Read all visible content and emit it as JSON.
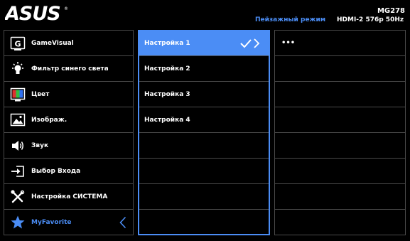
{
  "brand": {
    "logo": "ASUS"
  },
  "header": {
    "model": "MG278",
    "mode": "Пейзажный режим",
    "signal": "HDMI-2  576p 50Hz"
  },
  "menu": {
    "items": [
      {
        "label": "GameVisual",
        "icon": "gamevisual-icon"
      },
      {
        "label": "Фильтр синего света",
        "icon": "lightbulb-icon"
      },
      {
        "label": "Цвет",
        "icon": "color-palette-icon"
      },
      {
        "label": "Изображ.",
        "icon": "image-icon"
      },
      {
        "label": "Звук",
        "icon": "speaker-icon"
      },
      {
        "label": "Выбор Входа",
        "icon": "input-select-icon"
      },
      {
        "label": "Настройка СИСТЕМА",
        "icon": "wrench-screwdriver-icon"
      },
      {
        "label": "MyFavorite",
        "icon": "star-icon",
        "selected": true
      }
    ]
  },
  "submenu": {
    "items": [
      {
        "label": "Настройка 1",
        "selected": true
      },
      {
        "label": "Настройка 2"
      },
      {
        "label": "Настройка 3"
      },
      {
        "label": "Настройка 4"
      }
    ]
  },
  "detail": {
    "value": "•••"
  },
  "colors": {
    "accent": "#4b8df5",
    "border": "#4a4a4a",
    "background": "#000000"
  }
}
